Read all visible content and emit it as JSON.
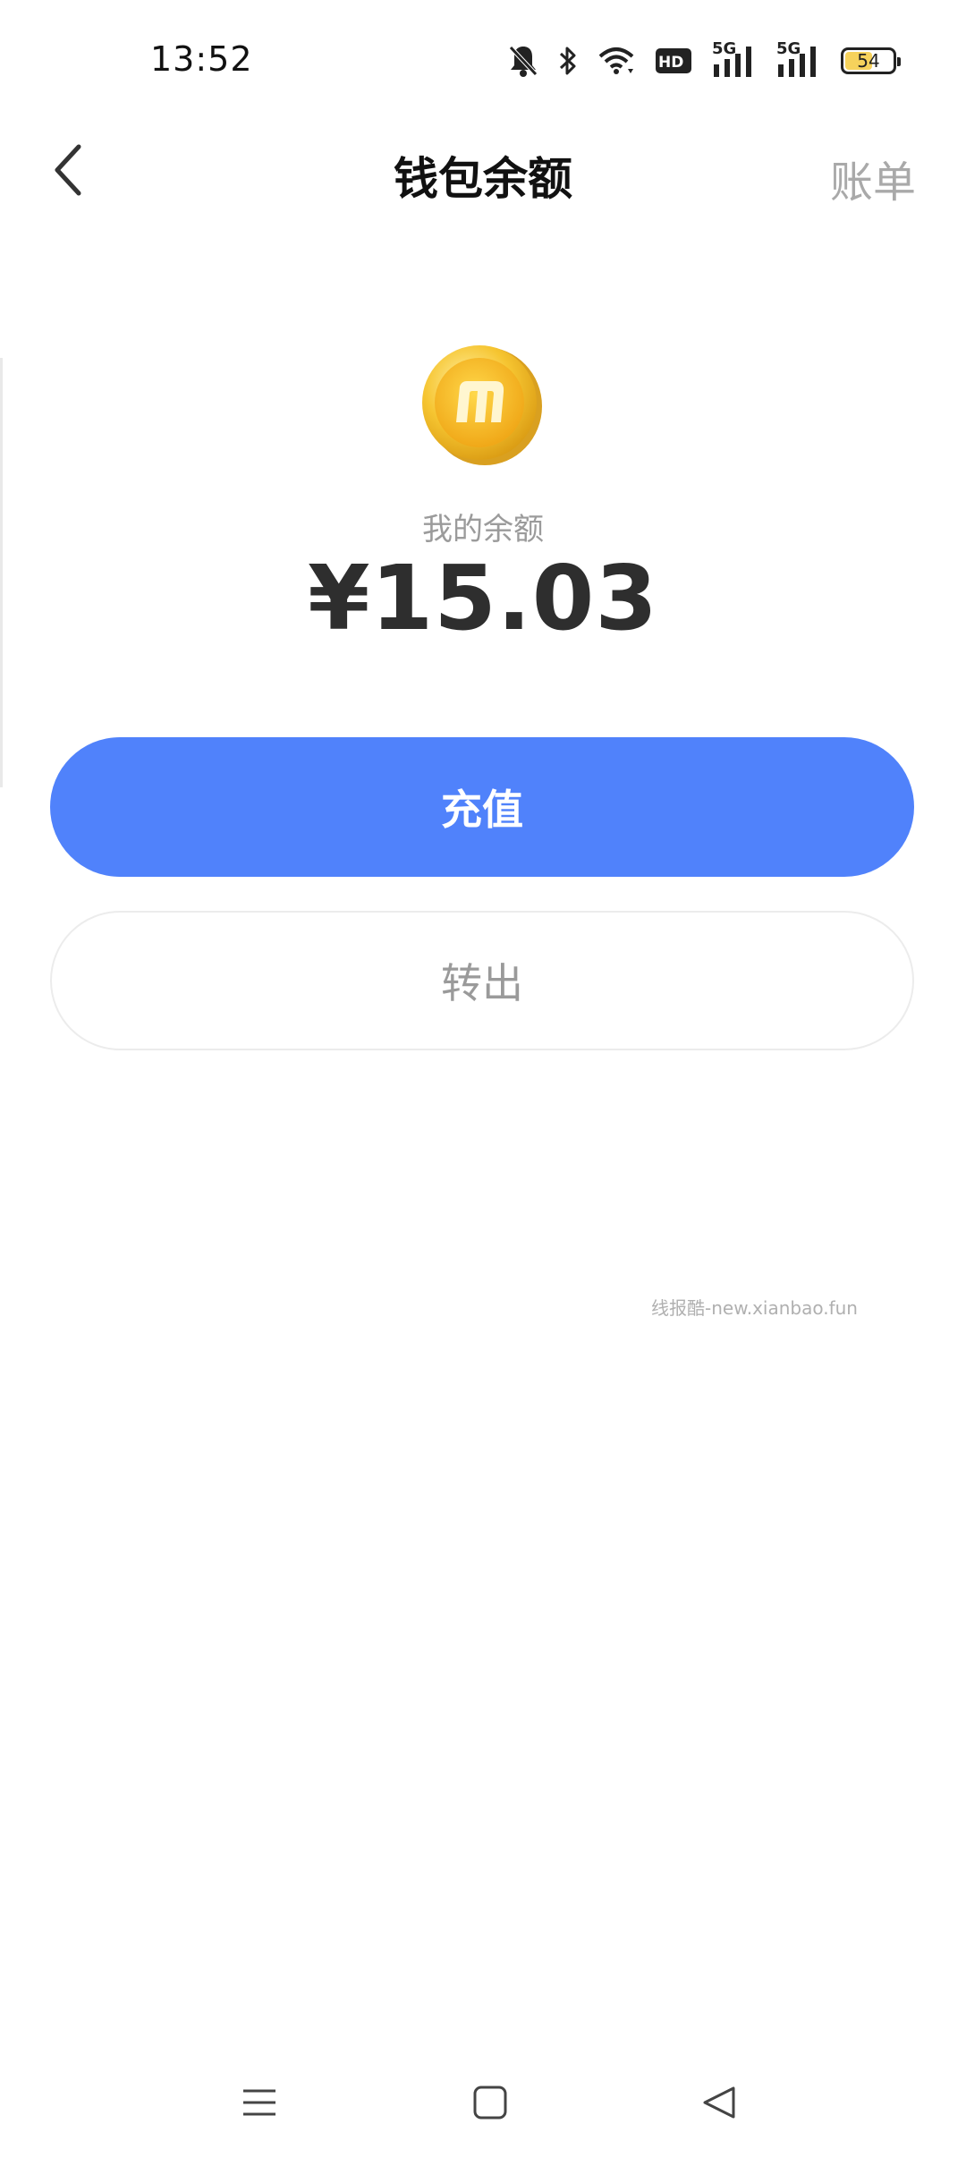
{
  "status_bar": {
    "time": "13:52",
    "battery": "54",
    "network_1": "5G",
    "network_2": "5G",
    "hd_label": "HD",
    "icons": [
      "bell-off-icon",
      "bluetooth-icon",
      "wifi-icon",
      "hd-icon",
      "signal-5g-icon",
      "signal-5g-icon",
      "battery-icon"
    ]
  },
  "header": {
    "back_icon": "chevron-left-icon",
    "title": "钱包余额",
    "bill_label": "账单"
  },
  "balance": {
    "icon": "gold-coin-icon",
    "label": "我的余额",
    "amount": "¥15.03"
  },
  "actions": {
    "recharge_label": "充值",
    "withdraw_label": "转出"
  },
  "watermark": "线报酷-new.xianbao.fun",
  "nav": {
    "icons": [
      "menu-icon",
      "home-square-icon",
      "back-triangle-icon"
    ]
  },
  "colors": {
    "primary": "#5082fb",
    "coin": "#f6c531",
    "muted_text": "#9b9b9b"
  }
}
